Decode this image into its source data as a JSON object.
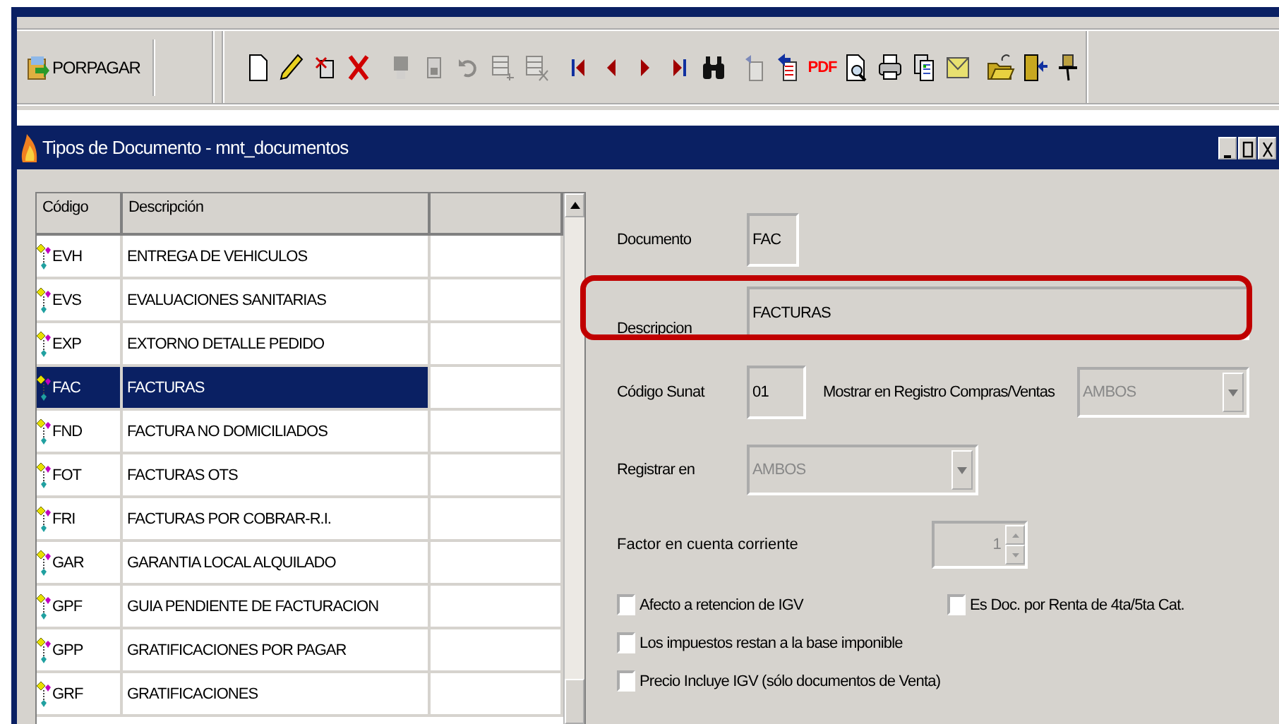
{
  "toolbar": {
    "module_button": {
      "label": "PORPAGAR"
    },
    "buttons": [
      {
        "disabled": false
      },
      {
        "disabled": false
      },
      {
        "disabled": false
      },
      {
        "disabled": false
      },
      {
        "disabled": true
      },
      {
        "disabled": true
      },
      {
        "disabled": true
      },
      {
        "disabled": true
      },
      {
        "disabled": true
      },
      {
        "disabled": false
      },
      {
        "disabled": false
      },
      {
        "disabled": false
      },
      {
        "disabled": false
      },
      {
        "disabled": false
      },
      {
        "disabled": true
      },
      {
        "disabled": false
      },
      {
        "disabled": false,
        "label": "PDF"
      },
      {
        "disabled": false
      },
      {
        "disabled": false
      },
      {
        "disabled": false
      },
      {
        "disabled": false
      },
      {
        "disabled": false
      },
      {
        "disabled": false
      },
      {
        "disabled": false
      }
    ]
  },
  "window": {
    "title": "Tipos de Documento - mnt_documentos"
  },
  "table": {
    "columns": [
      "Código",
      "Descripción"
    ],
    "rows": [
      {
        "code": "EVH",
        "description": "ENTREGA DE VEHICULOS",
        "selected": false
      },
      {
        "code": "EVS",
        "description": "EVALUACIONES SANITARIAS",
        "selected": false
      },
      {
        "code": "EXP",
        "description": "EXTORNO DETALLE PEDIDO",
        "selected": false
      },
      {
        "code": "FAC",
        "description": "FACTURAS",
        "selected": true
      },
      {
        "code": "FND",
        "description": "FACTURA NO DOMICILIADOS",
        "selected": false
      },
      {
        "code": "FOT",
        "description": "FACTURAS OTS",
        "selected": false
      },
      {
        "code": "FRI",
        "description": "FACTURAS POR COBRAR-R.I.",
        "selected": false
      },
      {
        "code": "GAR",
        "description": "GARANTIA LOCAL ALQUILADO",
        "selected": false
      },
      {
        "code": "GPF",
        "description": "GUIA PENDIENTE DE FACTURACION",
        "selected": false
      },
      {
        "code": "GPP",
        "description": "GRATIFICACIONES POR PAGAR",
        "selected": false
      },
      {
        "code": "GRF",
        "description": "GRATIFICACIONES",
        "selected": false
      }
    ]
  },
  "form": {
    "documento": {
      "label": "Documento",
      "value": "FAC"
    },
    "descripcion": {
      "label": "Descripcion",
      "value": "FACTURAS",
      "highlighted": true
    },
    "codigo_sunat": {
      "label": "Código Sunat",
      "value": "01"
    },
    "mostrar": {
      "label": "Mostrar en Registro Compras/Ventas",
      "value": "AMBOS",
      "disabled": true
    },
    "registrar": {
      "label": "Registrar en",
      "value": "AMBOS",
      "disabled": true
    },
    "factor": {
      "label": "Factor en cuenta corriente",
      "value": "1",
      "disabled": true
    },
    "checkboxes": [
      {
        "label": "Afecto a retencion de IGV",
        "checked": false
      },
      {
        "label": "Es Doc. por Renta de 4ta/5ta Cat.",
        "checked": false
      },
      {
        "label": "Los impuestos restan a la base imponible",
        "checked": false
      },
      {
        "label": "Precio Incluye IGV (sólo documentos de Venta)",
        "checked": false
      }
    ]
  }
}
